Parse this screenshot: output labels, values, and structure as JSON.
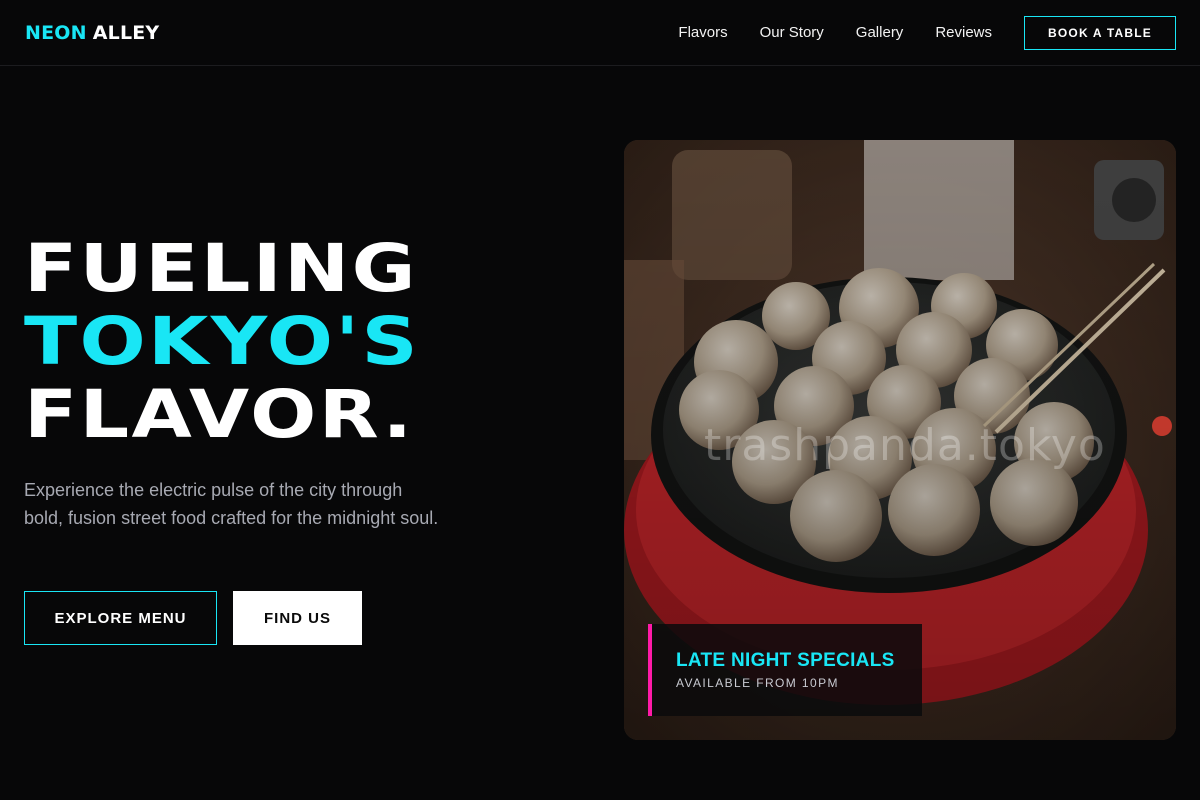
{
  "nav": {
    "logo_part1": "NEON",
    "logo_part2": "ALLEY",
    "links": [
      "Flavors",
      "Our Story",
      "Gallery",
      "Reviews"
    ],
    "cta": "BOOK A TABLE"
  },
  "hero": {
    "headline": [
      "FUELING",
      "TOKYO'S",
      "FLAVOR."
    ],
    "subtext": "Experience the electric pulse of the city through bold, fusion street food crafted for the midnight soul.",
    "primary_button": "EXPLORE MENU",
    "secondary_button": "FIND US"
  },
  "image": {
    "watermark": "trashpanda.tokyo",
    "card_title": "LATE NIGHT SPECIALS",
    "card_subtitle": "AVAILABLE FROM 10PM"
  },
  "colors": {
    "background": "#070708",
    "accent_cyan": "#19e6f5",
    "accent_pink": "#ff1aa8",
    "muted_text": "#a7a9b2"
  },
  "icons": [
    "takoyaki-photo"
  ]
}
